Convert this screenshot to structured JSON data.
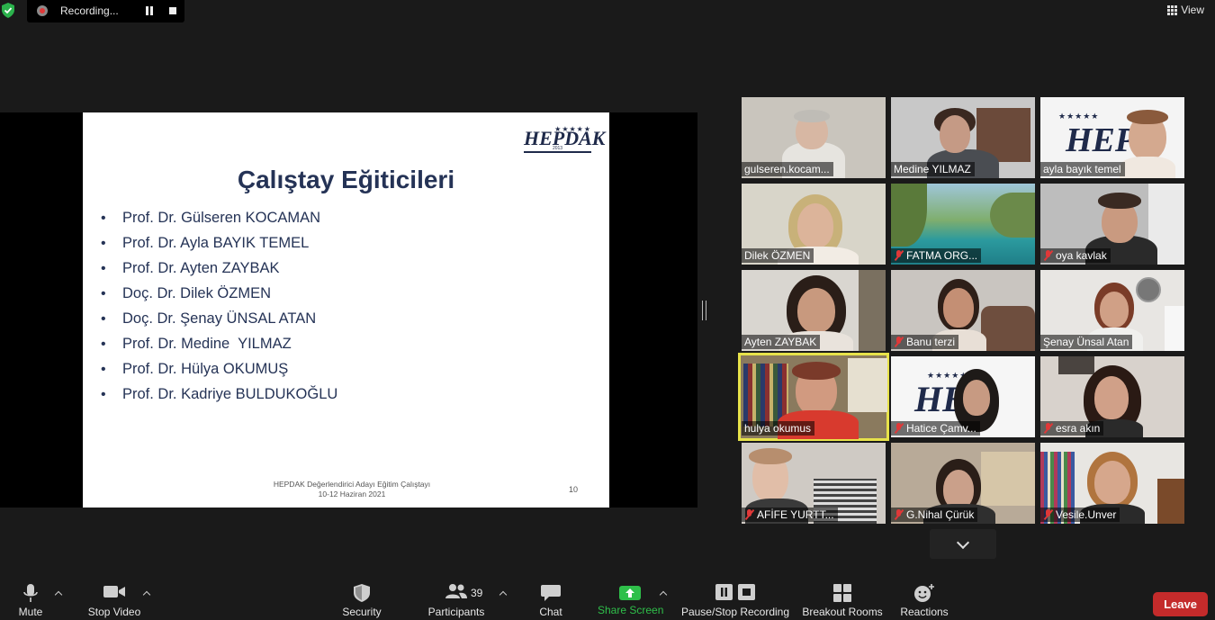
{
  "top_bar": {
    "recording_label": "Recording...",
    "view_label": "View"
  },
  "slide": {
    "logo_text": "HEPDAK",
    "logo_year": "2013",
    "title": "Çalıştay Eğiticileri",
    "items": [
      "Prof. Dr. Gülseren KOCAMAN",
      "Prof. Dr. Ayla BAYIK TEMEL",
      "Prof. Dr. Ayten ZAYBAK",
      "Doç. Dr. Dilek ÖZMEN",
      "Doç. Dr. Şenay ÜNSAL ATAN",
      "Prof. Dr. Medine  YILMAZ",
      "Prof. Dr. Hülya OKUMUŞ",
      "Prof. Dr. Kadriye BULDUKOĞLU"
    ],
    "footer_line1": "HEPDAK Değerlendirici Adayı Eğitim Çalıştayı",
    "footer_line2": "10-12 Haziran 2021",
    "page_number": "10"
  },
  "gallery": {
    "participants": [
      {
        "name": "gulseren.kocam...",
        "muted": false,
        "active": false
      },
      {
        "name": "Medine YILMAZ",
        "muted": false,
        "active": false
      },
      {
        "name": "ayla bayık temel",
        "muted": false,
        "active": false
      },
      {
        "name": "Dilek ÖZMEN",
        "muted": false,
        "active": false
      },
      {
        "name": "FATMA ORG...",
        "muted": true,
        "active": false
      },
      {
        "name": "oya kavlak",
        "muted": true,
        "active": false
      },
      {
        "name": "Ayten ZAYBAK",
        "muted": false,
        "active": false
      },
      {
        "name": "Banu terzi",
        "muted": true,
        "active": false
      },
      {
        "name": "Şenay Ünsal Atan",
        "muted": false,
        "active": false
      },
      {
        "name": "hulya okumus",
        "muted": false,
        "active": true
      },
      {
        "name": "Hatice Çamv...",
        "muted": true,
        "active": false
      },
      {
        "name": "esra akın",
        "muted": true,
        "active": false
      },
      {
        "name": "AFİFE YURTT...",
        "muted": true,
        "active": false
      },
      {
        "name": "G.Nihal Çürük",
        "muted": true,
        "active": false
      },
      {
        "name": "Vesile.Unver",
        "muted": true,
        "active": false
      }
    ]
  },
  "toolbar": {
    "mute_label": "Mute",
    "stop_video_label": "Stop Video",
    "security_label": "Security",
    "participants_label": "Participants",
    "participants_count": "39",
    "chat_label": "Chat",
    "share_screen_label": "Share Screen",
    "pause_stop_recording_label": "Pause/Stop Recording",
    "breakout_rooms_label": "Breakout Rooms",
    "reactions_label": "Reactions",
    "leave_label": "Leave"
  },
  "colors": {
    "background": "#1a1a1a",
    "active_speaker_border": "#e7e24a",
    "leave_red": "#c42b2b",
    "share_green": "#2fbf4a",
    "muted_red": "#e03838",
    "slide_navy": "#253356"
  }
}
